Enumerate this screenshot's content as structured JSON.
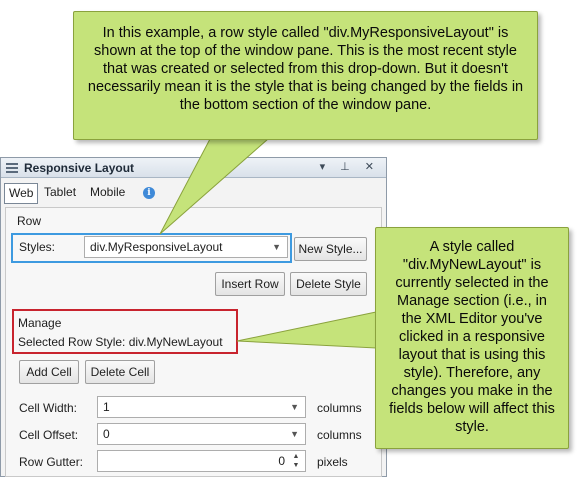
{
  "callouts": {
    "top": "In this example, a row style called \"div.MyResponsiveLayout\" is shown at the top of the window pane. This is the most recent style that was created or selected from this drop-down. But it doesn't necessarily mean it is the style that is being changed by the fields in the bottom section of the window pane.",
    "right": "A style called \"div.MyNewLayout\" is currently selected in the Manage section (i.e., in the XML Editor you've clicked in a responsive layout that is using this style). Therefore, any changes you make in the fields below will affect this style."
  },
  "panel": {
    "title": "Responsive Layout",
    "titlebar_icons": "▾ ⊥ ✕",
    "tabs": [
      "Web",
      "Tablet",
      "Mobile"
    ],
    "info_glyph": "i",
    "row": {
      "heading": "Row",
      "styles_label": "Styles:",
      "styles_value": "div.MyResponsiveLayout",
      "new_style_button": "New Style...",
      "insert_row_button": "Insert Row",
      "delete_style_button": "Delete Style"
    },
    "manage": {
      "heading": "Manage",
      "selected_row_style": "Selected Row Style: div.MyNewLayout",
      "add_cell_button": "Add Cell",
      "delete_cell_button": "Delete Cell"
    },
    "fields": {
      "cell_width_label": "Cell Width:",
      "cell_width_value": "1",
      "cell_width_unit": "columns",
      "cell_offset_label": "Cell Offset:",
      "cell_offset_value": "0",
      "cell_offset_unit": "columns",
      "row_gutter_label": "Row Gutter:",
      "row_gutter_value": "0",
      "row_gutter_unit": "pixels"
    }
  },
  "colors": {
    "callout_fill": "#c5e37a",
    "highlight_blue": "#3d9ae0",
    "highlight_red": "#c8242e"
  }
}
